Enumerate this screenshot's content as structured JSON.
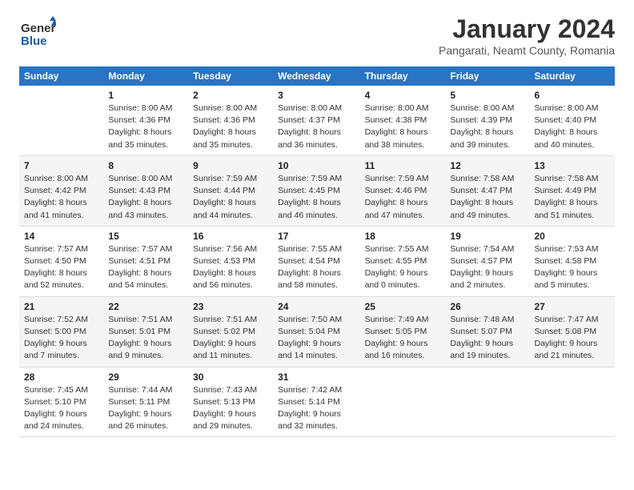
{
  "logo": {
    "line1": "General",
    "line2": "Blue"
  },
  "title": "January 2024",
  "subtitle": "Pangarati, Neamt County, Romania",
  "header_days": [
    "Sunday",
    "Monday",
    "Tuesday",
    "Wednesday",
    "Thursday",
    "Friday",
    "Saturday"
  ],
  "weeks": [
    [
      {
        "day": "",
        "info": ""
      },
      {
        "day": "1",
        "info": "Sunrise: 8:00 AM\nSunset: 4:36 PM\nDaylight: 8 hours\nand 35 minutes."
      },
      {
        "day": "2",
        "info": "Sunrise: 8:00 AM\nSunset: 4:36 PM\nDaylight: 8 hours\nand 35 minutes."
      },
      {
        "day": "3",
        "info": "Sunrise: 8:00 AM\nSunset: 4:37 PM\nDaylight: 8 hours\nand 36 minutes."
      },
      {
        "day": "4",
        "info": "Sunrise: 8:00 AM\nSunset: 4:38 PM\nDaylight: 8 hours\nand 38 minutes."
      },
      {
        "day": "5",
        "info": "Sunrise: 8:00 AM\nSunset: 4:39 PM\nDaylight: 8 hours\nand 39 minutes."
      },
      {
        "day": "6",
        "info": "Sunrise: 8:00 AM\nSunset: 4:40 PM\nDaylight: 8 hours\nand 40 minutes."
      }
    ],
    [
      {
        "day": "7",
        "info": "Sunrise: 8:00 AM\nSunset: 4:42 PM\nDaylight: 8 hours\nand 41 minutes."
      },
      {
        "day": "8",
        "info": "Sunrise: 8:00 AM\nSunset: 4:43 PM\nDaylight: 8 hours\nand 43 minutes."
      },
      {
        "day": "9",
        "info": "Sunrise: 7:59 AM\nSunset: 4:44 PM\nDaylight: 8 hours\nand 44 minutes."
      },
      {
        "day": "10",
        "info": "Sunrise: 7:59 AM\nSunset: 4:45 PM\nDaylight: 8 hours\nand 46 minutes."
      },
      {
        "day": "11",
        "info": "Sunrise: 7:59 AM\nSunset: 4:46 PM\nDaylight: 8 hours\nand 47 minutes."
      },
      {
        "day": "12",
        "info": "Sunrise: 7:58 AM\nSunset: 4:47 PM\nDaylight: 8 hours\nand 49 minutes."
      },
      {
        "day": "13",
        "info": "Sunrise: 7:58 AM\nSunset: 4:49 PM\nDaylight: 8 hours\nand 51 minutes."
      }
    ],
    [
      {
        "day": "14",
        "info": "Sunrise: 7:57 AM\nSunset: 4:50 PM\nDaylight: 8 hours\nand 52 minutes."
      },
      {
        "day": "15",
        "info": "Sunrise: 7:57 AM\nSunset: 4:51 PM\nDaylight: 8 hours\nand 54 minutes."
      },
      {
        "day": "16",
        "info": "Sunrise: 7:56 AM\nSunset: 4:53 PM\nDaylight: 8 hours\nand 56 minutes."
      },
      {
        "day": "17",
        "info": "Sunrise: 7:55 AM\nSunset: 4:54 PM\nDaylight: 8 hours\nand 58 minutes."
      },
      {
        "day": "18",
        "info": "Sunrise: 7:55 AM\nSunset: 4:55 PM\nDaylight: 9 hours\nand 0 minutes."
      },
      {
        "day": "19",
        "info": "Sunrise: 7:54 AM\nSunset: 4:57 PM\nDaylight: 9 hours\nand 2 minutes."
      },
      {
        "day": "20",
        "info": "Sunrise: 7:53 AM\nSunset: 4:58 PM\nDaylight: 9 hours\nand 5 minutes."
      }
    ],
    [
      {
        "day": "21",
        "info": "Sunrise: 7:52 AM\nSunset: 5:00 PM\nDaylight: 9 hours\nand 7 minutes."
      },
      {
        "day": "22",
        "info": "Sunrise: 7:51 AM\nSunset: 5:01 PM\nDaylight: 9 hours\nand 9 minutes."
      },
      {
        "day": "23",
        "info": "Sunrise: 7:51 AM\nSunset: 5:02 PM\nDaylight: 9 hours\nand 11 minutes."
      },
      {
        "day": "24",
        "info": "Sunrise: 7:50 AM\nSunset: 5:04 PM\nDaylight: 9 hours\nand 14 minutes."
      },
      {
        "day": "25",
        "info": "Sunrise: 7:49 AM\nSunset: 5:05 PM\nDaylight: 9 hours\nand 16 minutes."
      },
      {
        "day": "26",
        "info": "Sunrise: 7:48 AM\nSunset: 5:07 PM\nDaylight: 9 hours\nand 19 minutes."
      },
      {
        "day": "27",
        "info": "Sunrise: 7:47 AM\nSunset: 5:08 PM\nDaylight: 9 hours\nand 21 minutes."
      }
    ],
    [
      {
        "day": "28",
        "info": "Sunrise: 7:45 AM\nSunset: 5:10 PM\nDaylight: 9 hours\nand 24 minutes."
      },
      {
        "day": "29",
        "info": "Sunrise: 7:44 AM\nSunset: 5:11 PM\nDaylight: 9 hours\nand 26 minutes."
      },
      {
        "day": "30",
        "info": "Sunrise: 7:43 AM\nSunset: 5:13 PM\nDaylight: 9 hours\nand 29 minutes."
      },
      {
        "day": "31",
        "info": "Sunrise: 7:42 AM\nSunset: 5:14 PM\nDaylight: 9 hours\nand 32 minutes."
      },
      {
        "day": "",
        "info": ""
      },
      {
        "day": "",
        "info": ""
      },
      {
        "day": "",
        "info": ""
      }
    ]
  ]
}
